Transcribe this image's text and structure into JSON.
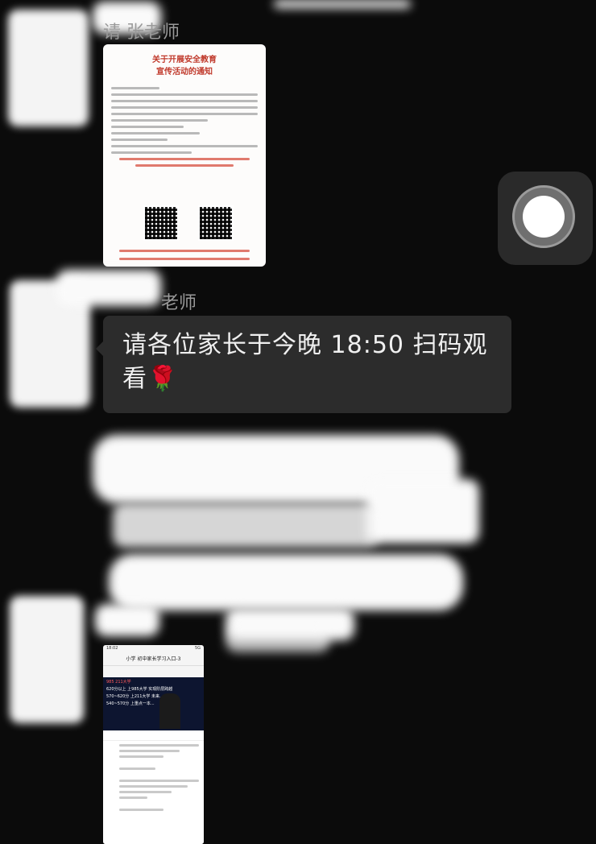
{
  "messages": [
    {
      "sender": "请 张老师",
      "type": "image",
      "poster": {
        "title_line1": "关于开展安全教育",
        "title_line2": "宣传活动的通知"
      }
    },
    {
      "sender": "老师",
      "type": "text",
      "text": "请各位家长于今晚 18:50 扫码观看🌹"
    },
    {
      "sender": "",
      "type": "image",
      "phone": {
        "status_time": "18:02",
        "status_right": "5G",
        "title": "小学 初中家长学习入口-3",
        "video_lines": [
          "985 211大学",
          "620分以上 上985大学 实现阶层跨越",
          "570~620分 上211大学 未来...",
          "540~570分 上重点一本..."
        ]
      }
    }
  ],
  "floating_button": {
    "icon": "assistive-touch-icon"
  },
  "colors": {
    "background": "#0b0b0b",
    "bubble": "#2c2c2c",
    "poster_red": "#c0392b"
  }
}
